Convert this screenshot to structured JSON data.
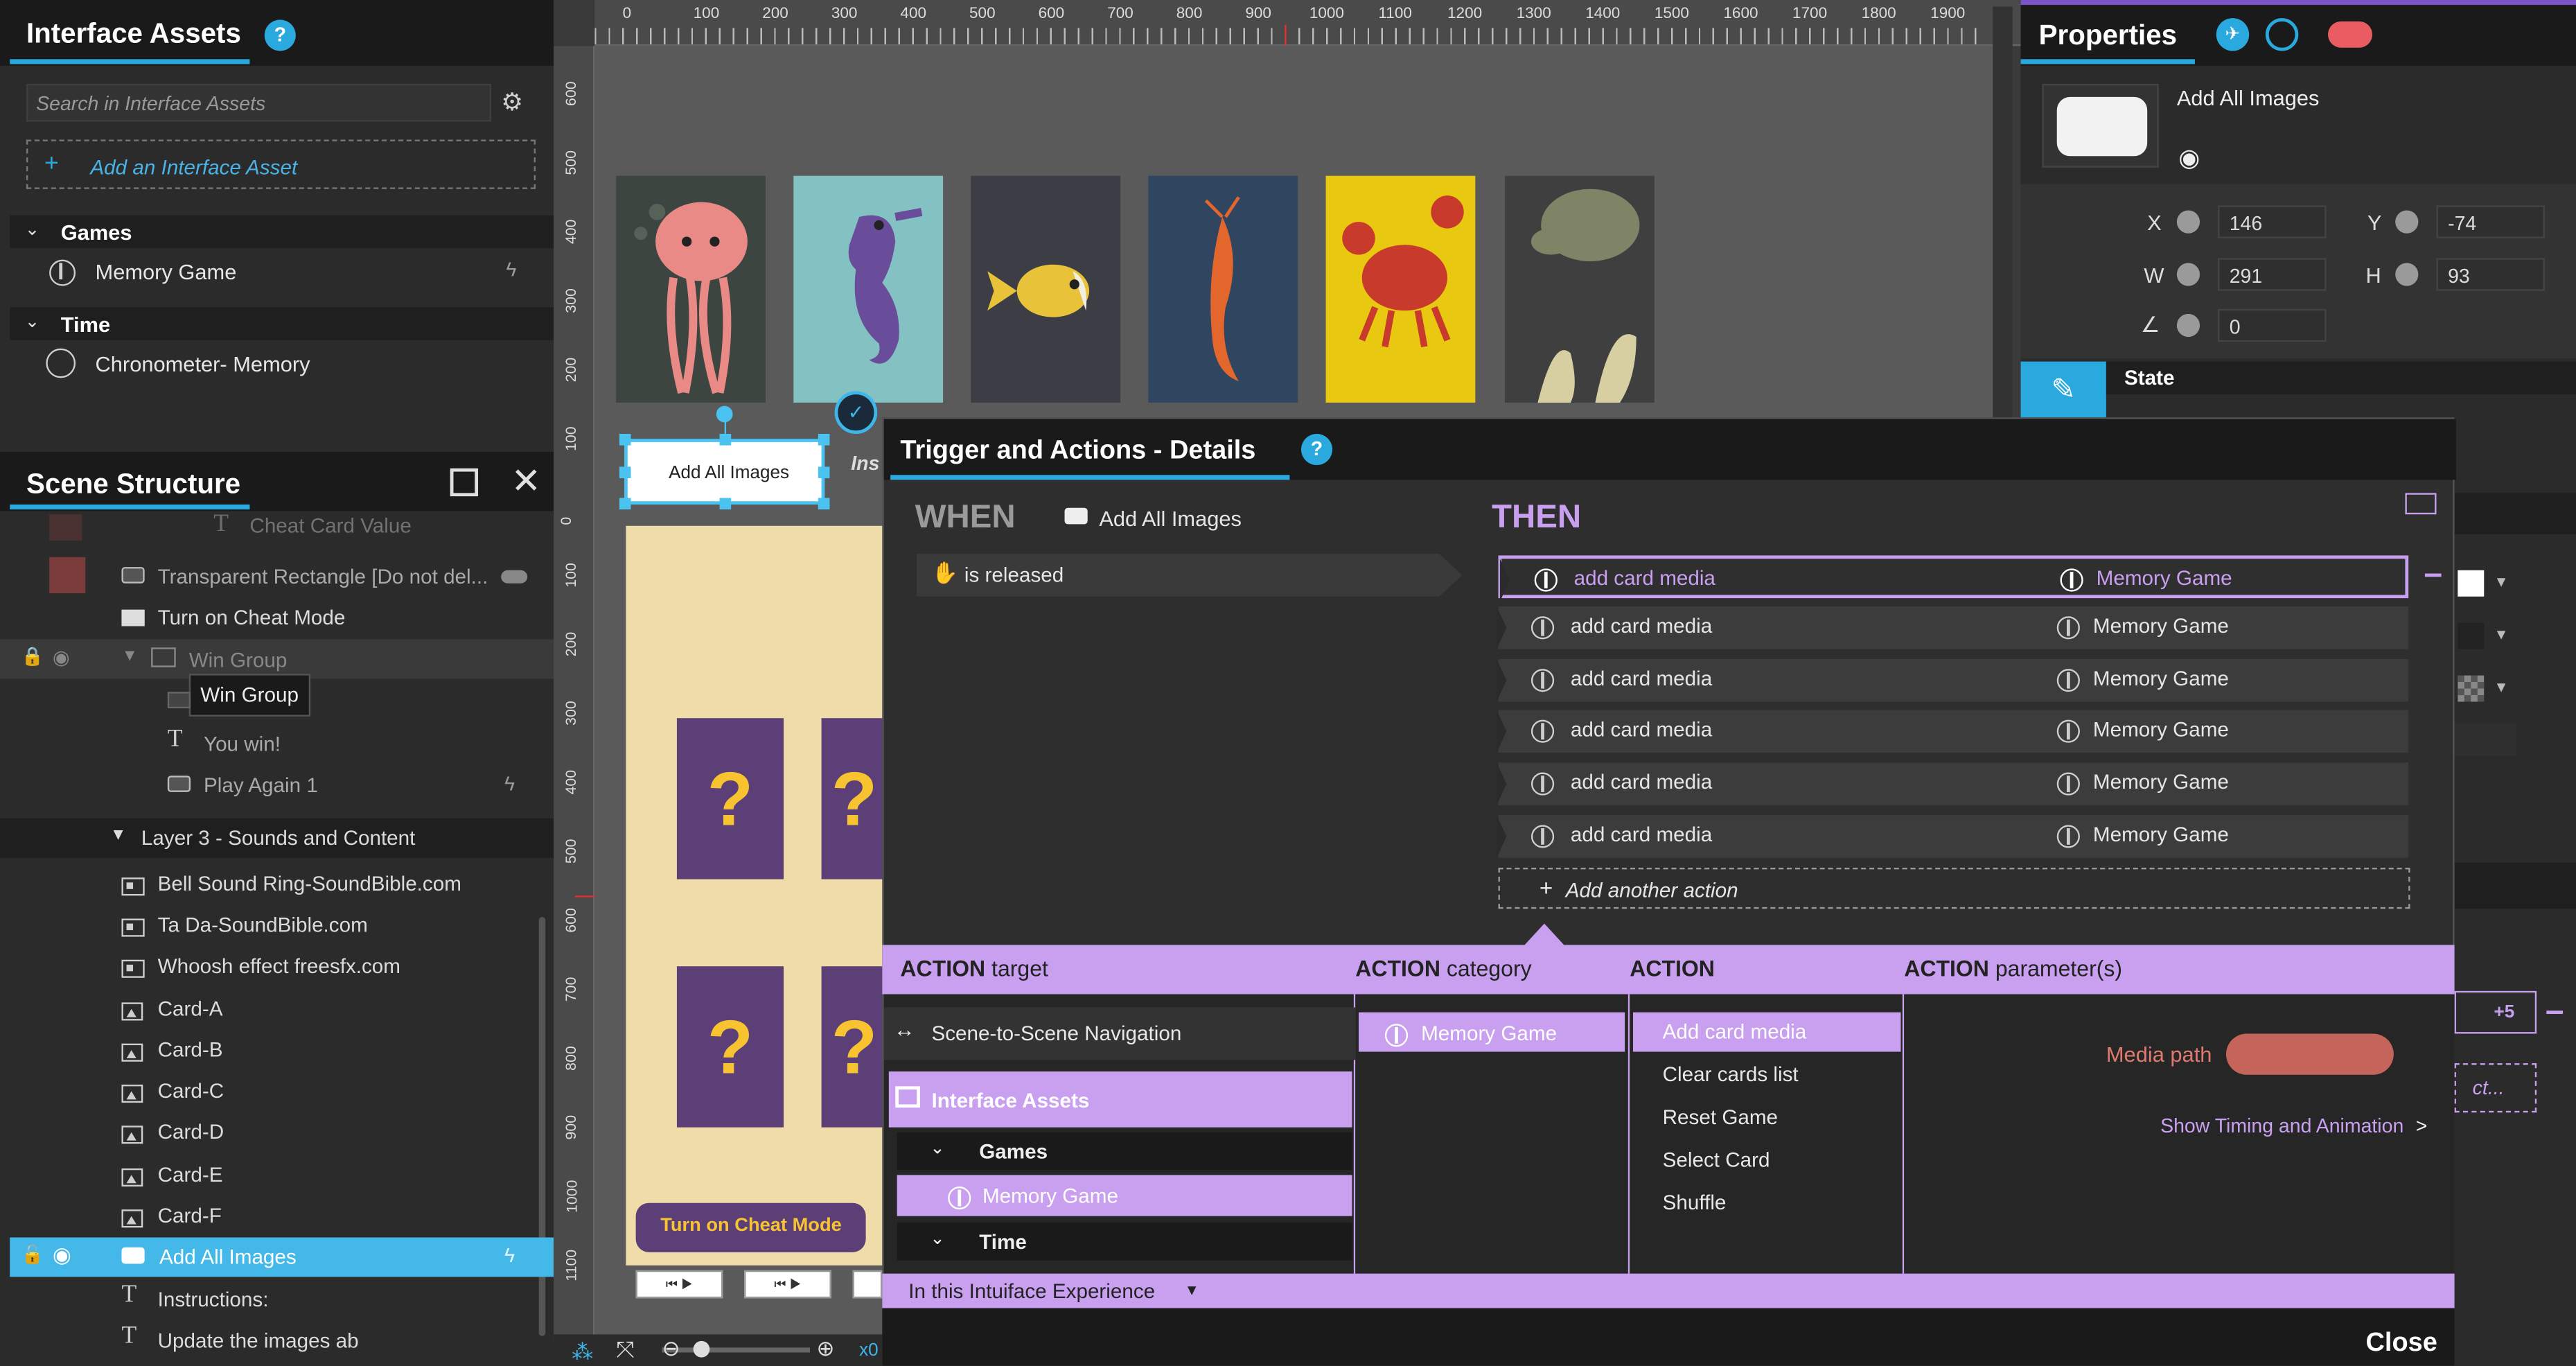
{
  "left_panel": {
    "title": "Interface Assets",
    "search_placeholder": "Search in Interface Assets",
    "add_asset": "Add an Interface Asset",
    "groups": [
      {
        "label": "Games",
        "items": [
          {
            "label": "Memory Game"
          }
        ]
      },
      {
        "label": "Time",
        "items": [
          {
            "label": "Chronometer- Memory"
          }
        ]
      }
    ]
  },
  "scene_structure": {
    "title": "Scene Structure",
    "rows": [
      {
        "label": "Cheat Card Value"
      },
      {
        "label": "Transparent Rectangle [Do not del..."
      },
      {
        "label": "Turn on Cheat Mode"
      },
      {
        "label": "Win Group"
      },
      {
        "label": "You win!"
      },
      {
        "label": "Play Again 1"
      },
      {
        "label": "Layer 3 - Sounds and Content"
      },
      {
        "label": "Bell Sound Ring-SoundBible.com"
      },
      {
        "label": "Ta Da-SoundBible.com"
      },
      {
        "label": "Whoosh effect freesfx.com"
      },
      {
        "label": "Card-A"
      },
      {
        "label": "Card-B"
      },
      {
        "label": "Card-C"
      },
      {
        "label": "Card-D"
      },
      {
        "label": "Card-E"
      },
      {
        "label": "Card-F"
      },
      {
        "label": "Add All Images"
      },
      {
        "label": "Instructions:"
      },
      {
        "label": "Update the images ab"
      }
    ],
    "tooltip": "Win Group"
  },
  "canvas": {
    "ruler_top": [
      "0",
      "100",
      "200",
      "300",
      "400",
      "500",
      "600",
      "700",
      "800",
      "900",
      "1000",
      "1100",
      "1200",
      "1300",
      "1400",
      "1500",
      "1600",
      "1700",
      "1800",
      "1900"
    ],
    "ruler_left_upper": [
      "600",
      "500",
      "400",
      "300",
      "200",
      "100"
    ],
    "ruler_left_lower": [
      "0",
      "100",
      "200",
      "300",
      "400",
      "500",
      "600",
      "700",
      "800",
      "900",
      "1000",
      "1100"
    ],
    "selected_button": "Add All Images",
    "ins_label": "Ins",
    "cheat_button": "Turn on Cheat Mode",
    "question_mark": "?",
    "zoom_label": "x0"
  },
  "properties": {
    "title": "Properties",
    "item_name": "Add All Images",
    "x_label": "X",
    "x_value": "146",
    "y_label": "Y",
    "y_value": "-74",
    "w_label": "W",
    "w_value": "291",
    "h_label": "H",
    "h_value": "93",
    "rot_value": "0",
    "state_label": "State"
  },
  "dialog": {
    "title": "Trigger and Actions - Details",
    "when_label": "WHEN",
    "when_target": "Add All Images",
    "trigger": "is released",
    "then_label": "THEN",
    "actions": [
      {
        "action": "add card media",
        "target": "Memory Game"
      },
      {
        "action": "add card media",
        "target": "Memory Game"
      },
      {
        "action": "add card media",
        "target": "Memory Game"
      },
      {
        "action": "add card media",
        "target": "Memory Game"
      },
      {
        "action": "add card media",
        "target": "Memory Game"
      },
      {
        "action": "add card media",
        "target": "Memory Game"
      }
    ],
    "add_another": "Add another action",
    "hdr_target_b": "ACTION",
    "hdr_target_s": "target",
    "hdr_category_b": "ACTION",
    "hdr_category_s": "category",
    "hdr_action": "ACTION",
    "hdr_params_b": "ACTION",
    "hdr_params_s": "parameter(s)",
    "target_items": {
      "nav": "Scene-to-Scene Navigation",
      "assets": "Interface Assets",
      "games": "Games",
      "memory": "Memory Game",
      "time": "Time"
    },
    "category": "Memory Game",
    "action_list": [
      "Add card media",
      "Clear cards list",
      "Reset Game",
      "Select Card",
      "Shuffle"
    ],
    "media_path_label": "Media path",
    "show_timing": "Show Timing and Animation",
    "scope": "In this Intuiface Experience",
    "close": "Close"
  },
  "right_edge": {
    "badge": "+5",
    "ct": "ct..."
  }
}
